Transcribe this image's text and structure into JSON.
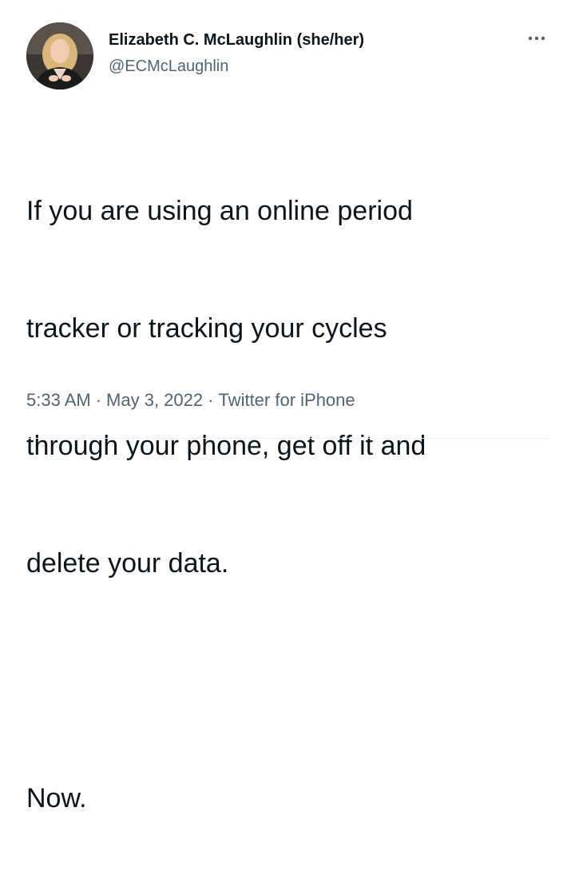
{
  "author": {
    "display_name": "Elizabeth C. McLaughlin (she/her)",
    "handle": "@ECMcLaughlin",
    "avatar_icon": "profile-photo"
  },
  "more_icon": "more-horizontal-icon",
  "tweet": {
    "lines": [
      "If you are using an online period",
      "tracker or tracking your cycles",
      "through your phone, get off it and",
      "delete your data."
    ],
    "closing": "Now."
  },
  "meta": {
    "time": "5:33 AM",
    "separator": "·",
    "date": "May 3, 2022",
    "source": "Twitter for iPhone"
  },
  "colors": {
    "text": "#0f1419",
    "secondary": "#536471",
    "divider": "#eff3f4"
  }
}
